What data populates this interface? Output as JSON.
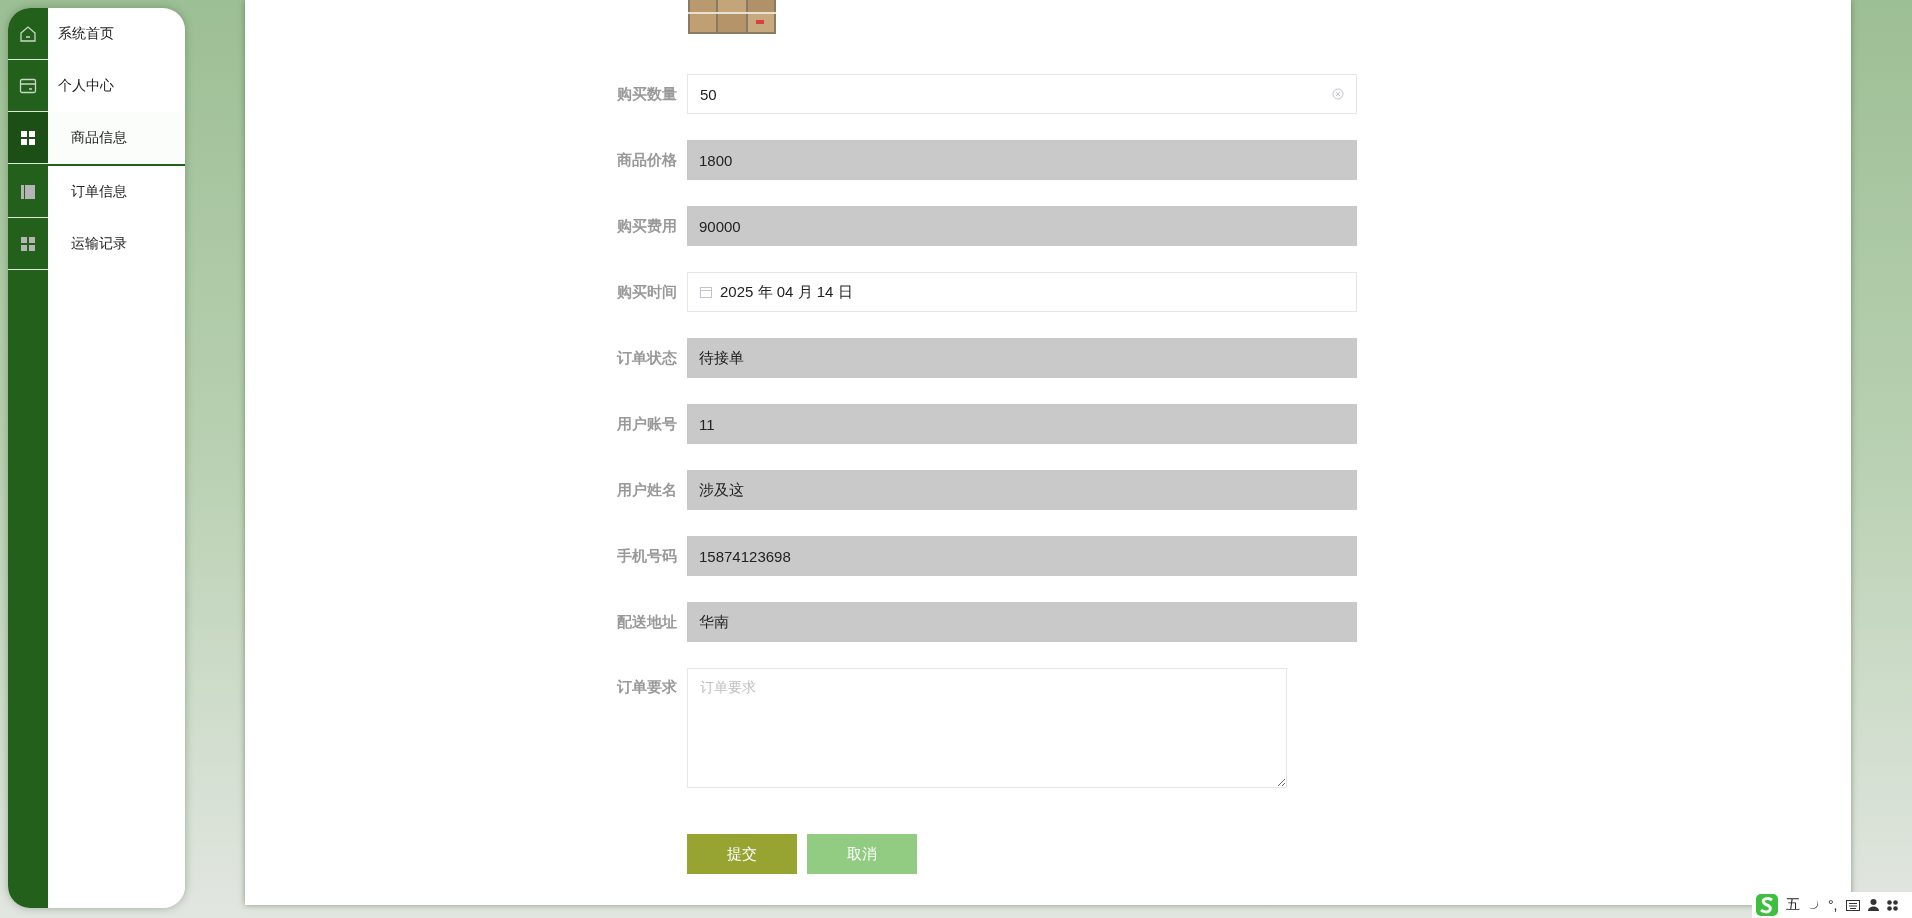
{
  "sidebar": {
    "items": [
      {
        "label": "系统首页",
        "sub": false,
        "selected": false
      },
      {
        "label": "个人中心",
        "sub": false,
        "selected": false
      },
      {
        "label": "商品信息",
        "sub": true,
        "selected": true
      },
      {
        "label": "订单信息",
        "sub": true,
        "selected": false
      },
      {
        "label": "运输记录",
        "sub": true,
        "selected": false
      }
    ]
  },
  "form": {
    "fields": [
      {
        "label": "购买数量",
        "value": "50",
        "kind": "input"
      },
      {
        "label": "商品价格",
        "value": "1800",
        "kind": "readonly"
      },
      {
        "label": "购买费用",
        "value": "90000",
        "kind": "readonly"
      },
      {
        "label": "购买时间",
        "value": "2025 年 04 月 14 日",
        "kind": "date"
      },
      {
        "label": "订单状态",
        "value": "待接单",
        "kind": "readonly"
      },
      {
        "label": "用户账号",
        "value": "11",
        "kind": "readonly"
      },
      {
        "label": "用户姓名",
        "value": "涉及这",
        "kind": "readonly"
      },
      {
        "label": "手机号码",
        "value": "15874123698",
        "kind": "readonly"
      },
      {
        "label": "配送地址",
        "value": "华南",
        "kind": "readonly"
      }
    ],
    "remark": {
      "label": "订单要求",
      "placeholder": "订单要求"
    },
    "buttons": [
      {
        "label": "提交",
        "kind": "primary"
      },
      {
        "label": "取消",
        "kind": "secondary"
      }
    ]
  },
  "ime_bar": {
    "mode": "五",
    "punct": "°,"
  }
}
